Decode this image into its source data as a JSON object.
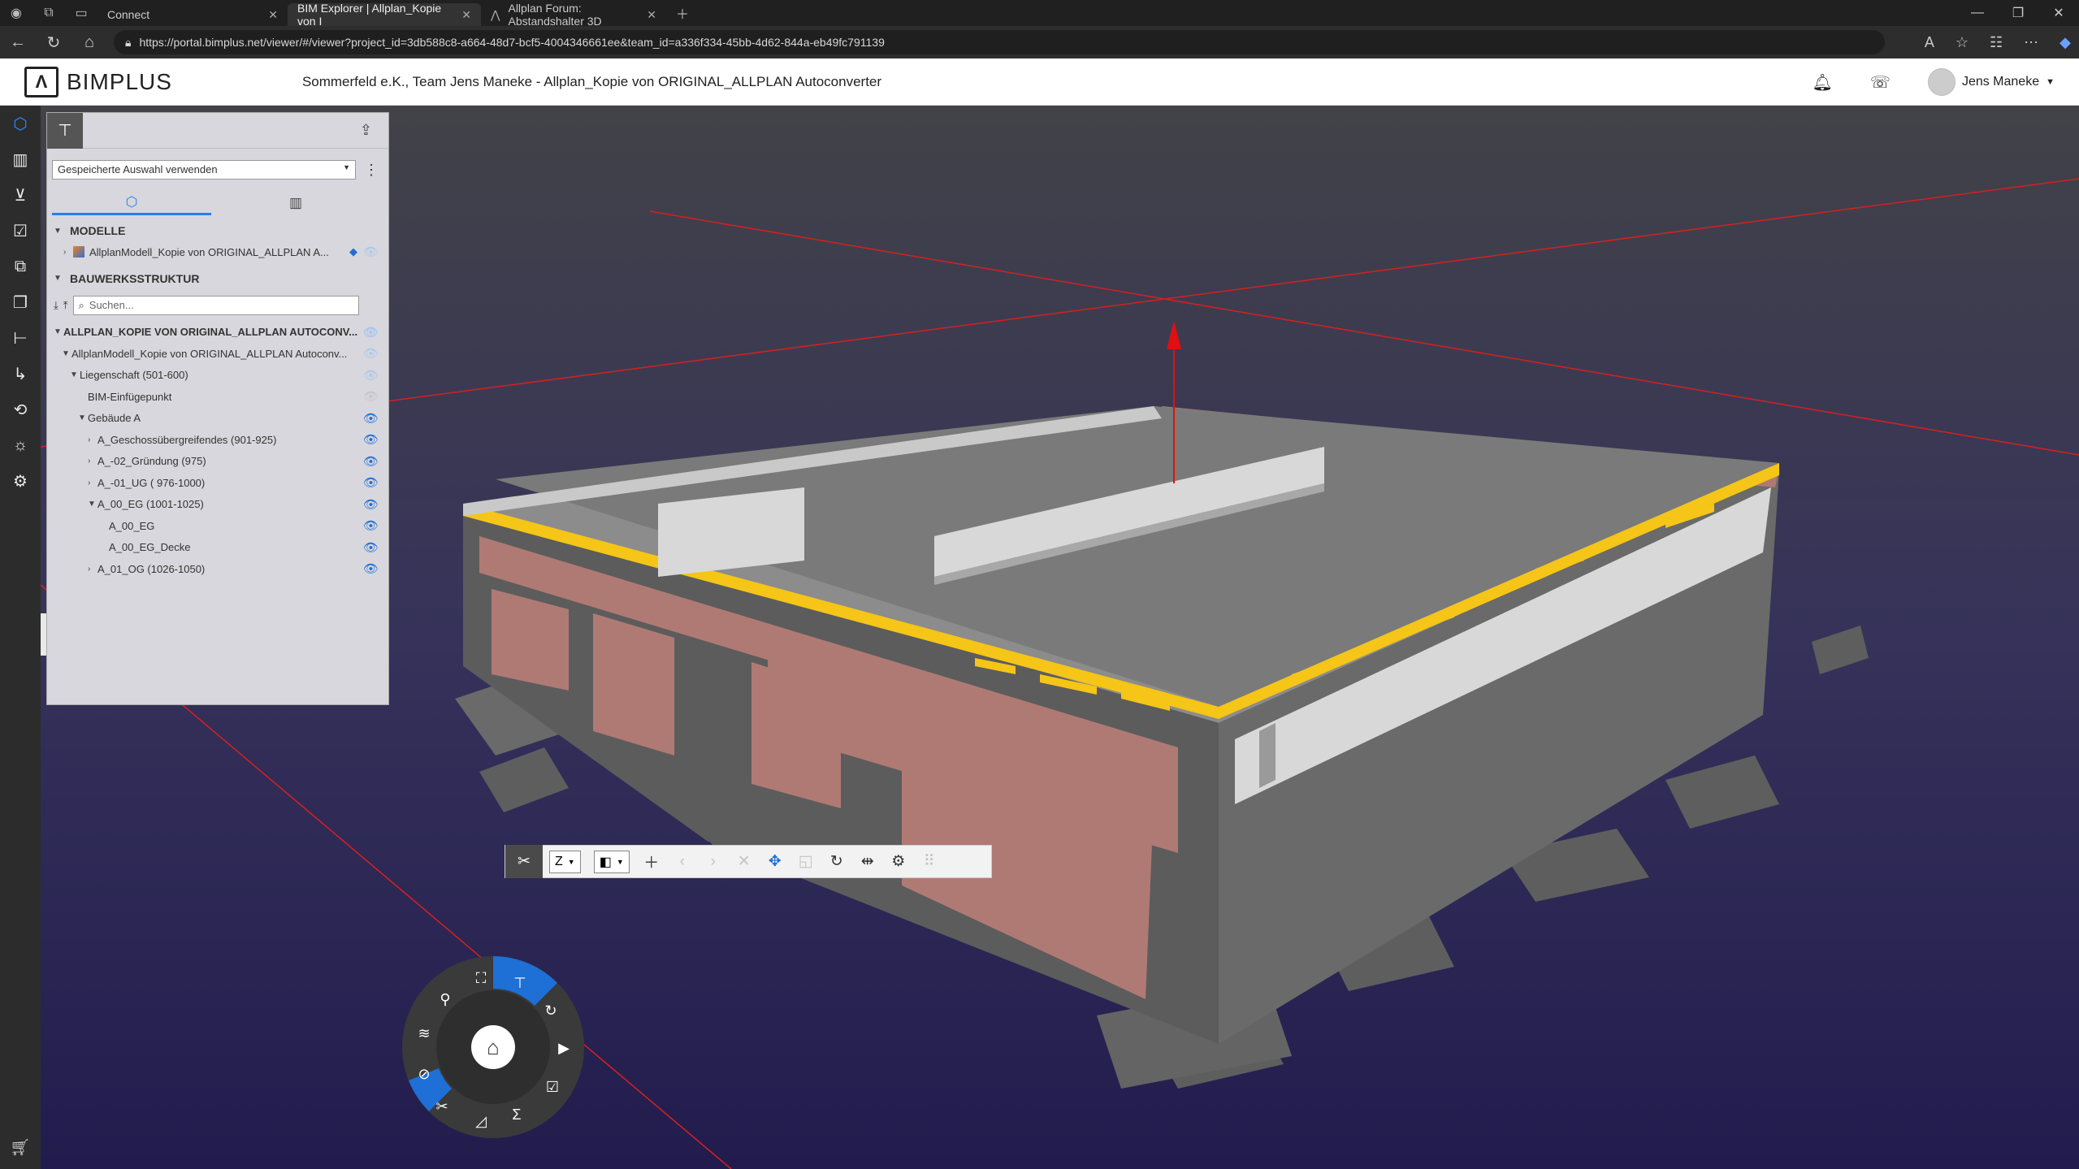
{
  "browser": {
    "tabs": [
      {
        "title": "Connect",
        "active": false
      },
      {
        "title": "BIM Explorer | Allplan_Kopie von I",
        "active": true
      },
      {
        "title": "Allplan Forum: Abstandshalter 3D",
        "active": false
      }
    ],
    "url": "https://portal.bimplus.net/viewer/#/viewer?project_id=3db588c8-a664-48d7-bcf5-4004346661ee&team_id=a336f334-45bb-4d62-844a-eb49fc791139"
  },
  "app": {
    "logo_text": "BIMPLUS",
    "project_title": "Sommerfeld e.K., Team Jens Maneke  -  Allplan_Kopie von ORIGINAL_ALLPLAN Autoconverter",
    "user_name": "Jens Maneke"
  },
  "panel": {
    "saved_selection": "Gespeicherte Auswahl verwenden",
    "models_header": "MODELLE",
    "model_name": "AllplanModell_Kopie von ORIGINAL_ALLPLAN A...",
    "structure_header": "BAUWERKSSTRUKTUR",
    "search_placeholder": "Suchen...",
    "tree": [
      {
        "label": "ALLPLAN_KOPIE VON ORIGINAL_ALLPLAN AUTOCONV...",
        "bold": true
      },
      {
        "label": "AllplanModell_Kopie von ORIGINAL_ALLPLAN Autoconv..."
      },
      {
        "label": "Liegenschaft (501-600)"
      },
      {
        "label": "BIM-Einfügepunkt"
      },
      {
        "label": "Gebäude A"
      },
      {
        "label": "A_Geschossübergreifendes (901-925)"
      },
      {
        "label": "A_-02_Gründung (975)"
      },
      {
        "label": "A_-01_UG ( 976-1000)"
      },
      {
        "label": "A_00_EG (1001-1025)"
      },
      {
        "label": "A_00_EG"
      },
      {
        "label": "A_00_EG_Decke"
      },
      {
        "label": "A_01_OG (1026-1050)"
      }
    ]
  },
  "toolbar": {
    "axis": "Z",
    "icons": [
      "section-icon",
      "view-cube-icon",
      "add-icon",
      "prev-icon",
      "next-icon",
      "delete-icon",
      "move-icon",
      "scale-icon",
      "rotate-icon",
      "flip-icon",
      "settings-icon"
    ]
  },
  "colors": {
    "accent": "#2b7de9",
    "viewport_top": "#424248",
    "viewport_bottom": "#221c4e",
    "wall_brick": "#b07a74",
    "concrete": "#6c6c6c",
    "cut_edge": "#f5c518"
  }
}
